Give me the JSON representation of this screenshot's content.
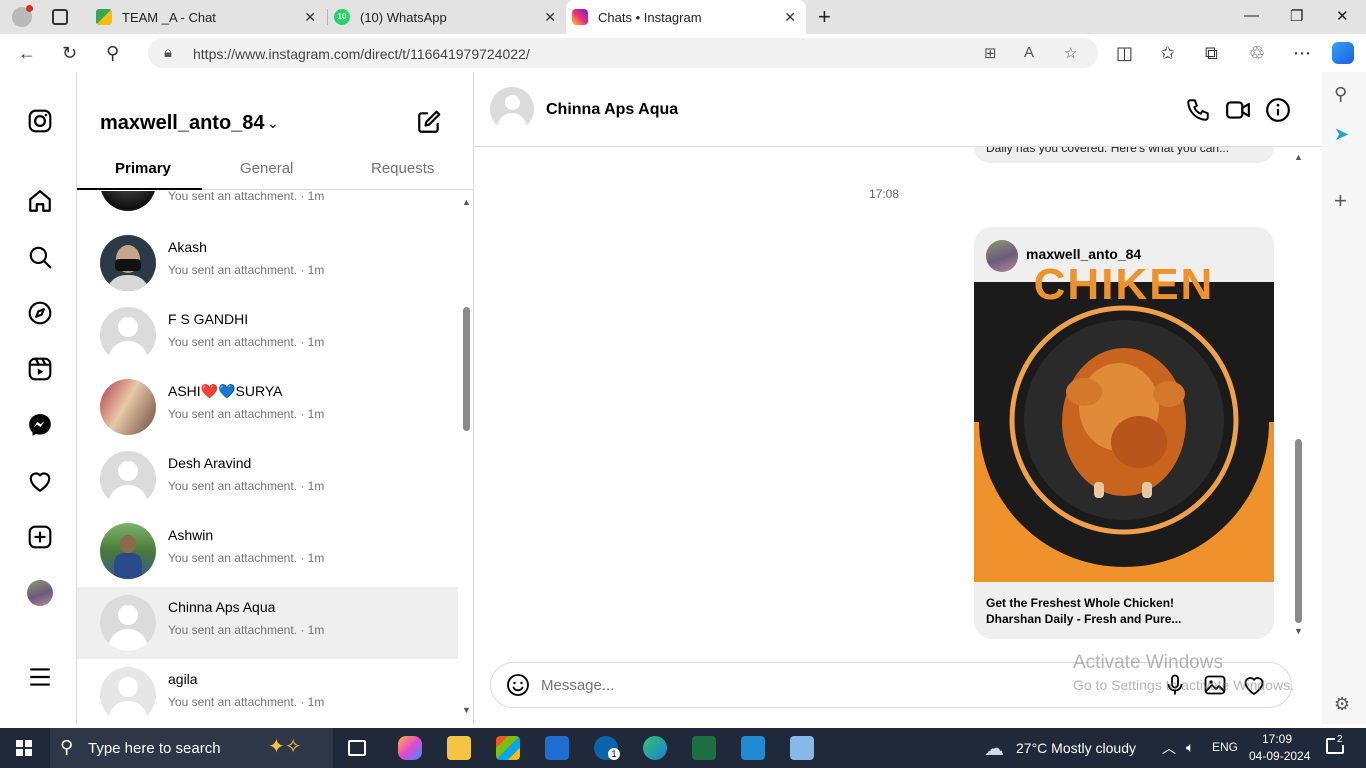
{
  "browser": {
    "tabs": [
      {
        "title": "TEAM _A - Chat",
        "icon": "google-chat-icon"
      },
      {
        "title": "(10) WhatsApp",
        "icon": "whatsapp-icon",
        "badge": "10"
      },
      {
        "title": "Chats • Instagram",
        "icon": "instagram-icon"
      }
    ],
    "url": "https://www.instagram.com/direct/t/116641979724022/"
  },
  "inbox": {
    "username": "maxwell_anto_84",
    "tabs": [
      "Primary",
      "General",
      "Requests"
    ],
    "active_tab": "Primary",
    "threads": [
      {
        "name": "",
        "preview": "You sent an attachment. · 1m",
        "avatar": "photo-dark"
      },
      {
        "name": "Akash",
        "preview": "You sent an attachment. · 1m",
        "avatar": "photo-mask"
      },
      {
        "name": "F S GANDHI",
        "preview": "You sent an attachment. · 1m",
        "avatar": "default"
      },
      {
        "name": "ASHI❤️💙SURYA",
        "preview": "You sent an attachment. · 1m",
        "avatar": "photo-couple"
      },
      {
        "name": "Desh Aravind",
        "preview": "You sent an attachment. · 1m",
        "avatar": "default"
      },
      {
        "name": "Ashwin",
        "preview": "You sent an attachment. · 1m",
        "avatar": "photo-outdoor"
      },
      {
        "name": "Chinna Aps Aqua",
        "preview": "You sent an attachment. · 1m",
        "avatar": "default",
        "selected": true
      },
      {
        "name": "agila",
        "preview": "You sent an attachment. · 1m",
        "avatar": "default-light"
      }
    ]
  },
  "chat": {
    "contact": "Chinna Aps Aqua",
    "prev_message_fragment": "Daily has you covered. Here's what you can...",
    "timestamp": "17:08",
    "shared_post": {
      "author": "maxwell_anto_84",
      "image_text": "CHIKEN",
      "caption_line1": "Get the Freshest Whole Chicken!",
      "caption_line2": "Dharshan Daily - Fresh and Pure..."
    },
    "composer_placeholder": "Message..."
  },
  "watermark": {
    "line1": "Activate Windows",
    "line2": "Go to Settings to activate Windows."
  },
  "taskbar": {
    "search_placeholder": "Type here to search",
    "weather": "27°C  Mostly cloudy",
    "language": "ENG",
    "time": "17:09",
    "date": "04-09-2024",
    "notifications": "2",
    "outlook_badge": "1"
  },
  "colors": {
    "accent_orange": "#f0922c",
    "taskbar": "#20293a",
    "instagram_border": "#dbdbdb"
  }
}
